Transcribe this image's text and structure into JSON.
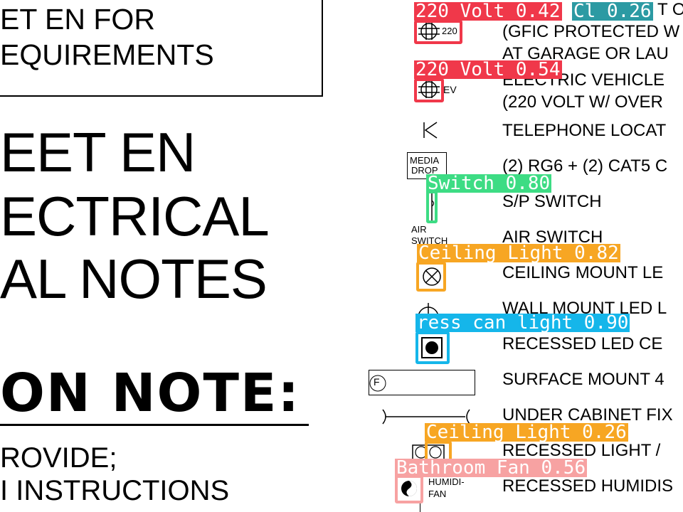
{
  "sheet": {
    "box_lines": [
      "ET EN FOR",
      "EQUIREMENTS"
    ],
    "title_lines": [
      "EET EN",
      "ECTRICAL",
      "AL NOTES"
    ],
    "note_heading": "ON NOTE:",
    "note_lines": [
      "ROVIDE;",
      "I INSTRUCTIONS"
    ]
  },
  "legend": {
    "rows": [
      {
        "desc": "T O"
      },
      {
        "desc": "(GFIC PROTECTED W"
      },
      {
        "desc": "AT GARAGE OR LAU"
      },
      {
        "desc": "ELECTRIC VEHICLE"
      },
      {
        "desc": "(220 VOLT W/ OVER"
      },
      {
        "desc": "TELEPHONE LOCAT"
      },
      {
        "desc": "(2) RG6 + (2) CAT5  C"
      },
      {
        "desc": "S/P SWITCH"
      },
      {
        "desc": "AIR SWITCH"
      },
      {
        "desc": "CEILING MOUNT LE"
      },
      {
        "desc": "WALL MOUNT LED L"
      },
      {
        "desc": "RECESSED LED CE"
      },
      {
        "desc": "SURFACE MOUNT 4"
      },
      {
        "desc": "UNDER CABINET FIX"
      },
      {
        "desc": "RECESSED LIGHT /"
      },
      {
        "desc": "RECESSED HUMIDIS"
      }
    ],
    "symbol_text": {
      "outlet_220": "220",
      "ev": "EV",
      "media_drop": [
        "MEDIA",
        "DROP"
      ],
      "air_switch": [
        "AIR",
        "SWITCH"
      ],
      "surface_mount": "F",
      "humidi_fan": [
        "HUMIDI-",
        "FAN"
      ]
    }
  },
  "detections": [
    {
      "label": "220 Volt 0.42",
      "color": "#f0384a"
    },
    {
      "label": "Cl 0.26",
      "color": "#2c9aa3"
    },
    {
      "label": "220 Volt 0.54",
      "color": "#f0384a"
    },
    {
      "label": "Switch 0.80",
      "color": "#3ddc84"
    },
    {
      "label": "Ceiling Light 0.82",
      "color": "#f7a623"
    },
    {
      "label": "ress_can_light 0.90",
      "color": "#15b6ea"
    },
    {
      "label": "Ceiling Light 0.26",
      "color": "#f7a623"
    },
    {
      "label": "Bathroom Fan 0.56",
      "color": "#f7a2a2"
    }
  ]
}
